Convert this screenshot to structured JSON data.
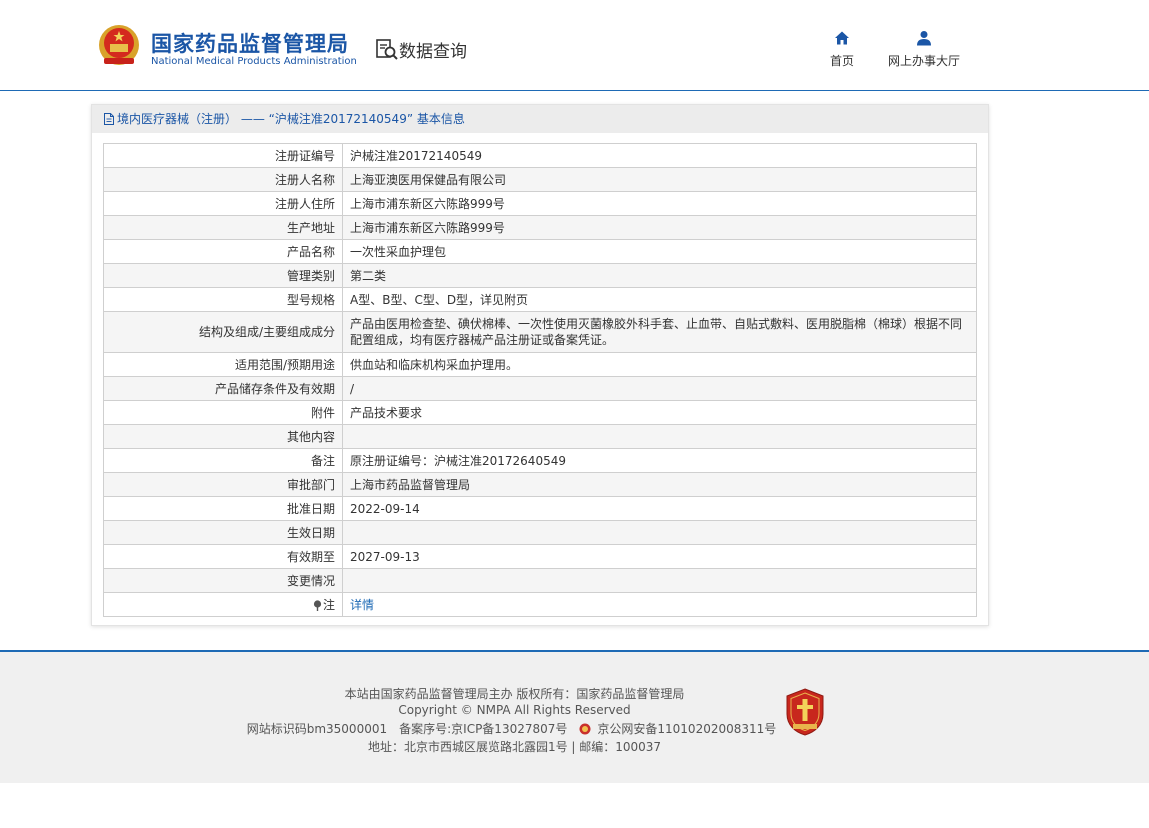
{
  "header": {
    "org_name_cn": "国家药品监督管理局",
    "org_name_en": "National Medical Products Administration",
    "query_label": "数据查询",
    "nav": [
      {
        "label": "首页",
        "icon": "home-icon"
      },
      {
        "label": "网上办事大厅",
        "icon": "user-icon"
      }
    ],
    "brand_color": "#1b56a6"
  },
  "panel": {
    "title": "境内医疗器械（注册） —— “沪械注准20172140549” 基本信息",
    "rows": [
      {
        "label": "注册证编号",
        "value": "沪械注准20172140549"
      },
      {
        "label": "注册人名称",
        "value": "上海亚澳医用保健品有限公司"
      },
      {
        "label": "注册人住所",
        "value": "上海市浦东新区六陈路999号"
      },
      {
        "label": "生产地址",
        "value": "上海市浦东新区六陈路999号"
      },
      {
        "label": "产品名称",
        "value": "一次性采血护理包"
      },
      {
        "label": "管理类别",
        "value": "第二类"
      },
      {
        "label": "型号规格",
        "value": "A型、B型、C型、D型，详见附页"
      },
      {
        "label": "结构及组成/主要组成成分",
        "value": "产品由医用检查垫、碘伏棉棒、一次性使用灭菌橡胶外科手套、止血带、自贴式敷料、医用脱脂棉（棉球）根据不同配置组成，均有医疗器械产品注册证或备案凭证。"
      },
      {
        "label": "适用范围/预期用途",
        "value": "供血站和临床机构采血护理用。"
      },
      {
        "label": "产品储存条件及有效期",
        "value": "/"
      },
      {
        "label": "附件",
        "value": "产品技术要求"
      },
      {
        "label": "其他内容",
        "value": ""
      },
      {
        "label": "备注",
        "value": "原注册证编号：沪械注准20172640549"
      },
      {
        "label": "审批部门",
        "value": "上海市药品监督管理局"
      },
      {
        "label": "批准日期",
        "value": "2022-09-14"
      },
      {
        "label": "生效日期",
        "value": ""
      },
      {
        "label": "有效期至",
        "value": "2027-09-13"
      },
      {
        "label": "变更情况",
        "value": ""
      }
    ],
    "note_label": "注",
    "note_link": "详情"
  },
  "footer": {
    "line1": "本站由国家药品监督管理局主办 版权所有：国家药品监督管理局",
    "line2": "Copyright © NMPA All Rights Reserved",
    "site_id": "网站标识码bm35000001",
    "icp": "备案序号:京ICP备13027807号",
    "police": "京公网安备11010202008311号",
    "address": "地址：北京市西城区展览路北露园1号 | 邮编：100037"
  }
}
